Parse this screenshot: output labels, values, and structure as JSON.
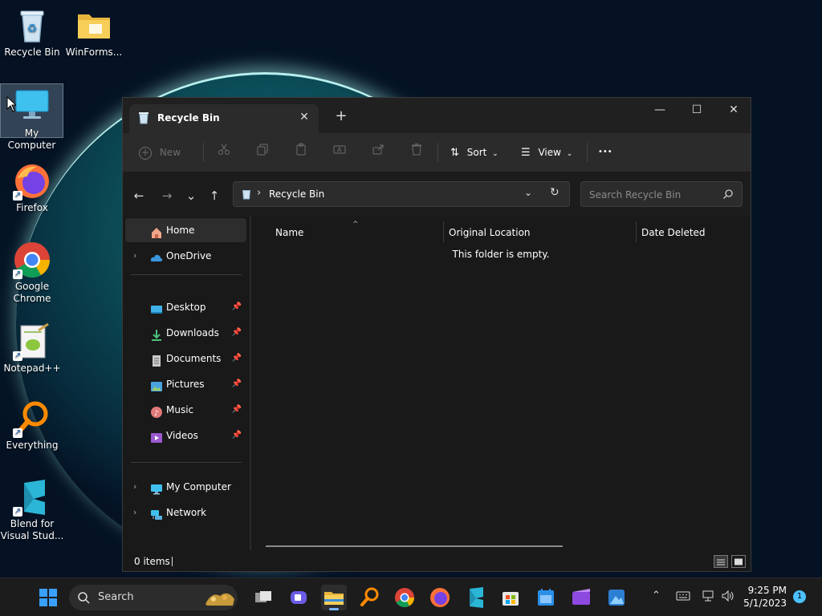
{
  "desktop": {
    "icons": {
      "recycle_bin": "Recycle Bin",
      "winforms": "WinForms...",
      "my_computer": "My Computer",
      "firefox": "Firefox",
      "chrome": "Google Chrome",
      "notepadpp": "Notepad++",
      "everything": "Everything",
      "blend": "Blend for Visual Stud..."
    }
  },
  "window": {
    "tab_title": "Recycle Bin",
    "tab_close_glyph": "✕",
    "new_tab_glyph": "+",
    "controls": {
      "minimize": "—",
      "maximize": "☐",
      "close": "✕"
    },
    "toolbar": {
      "new_label": "New",
      "sort_label": "Sort",
      "view_label": "View",
      "more_glyph": "•••"
    },
    "nav_glyphs": {
      "back": "←",
      "forward": "→",
      "recent": "⌄",
      "up": "↑"
    },
    "address": {
      "separator": "›",
      "location": "Recycle Bin"
    },
    "search": {
      "placeholder": "Search Recycle Bin"
    },
    "navpane": {
      "home": "Home",
      "onedrive": "OneDrive",
      "desktop": "Desktop",
      "downloads": "Downloads",
      "documents": "Documents",
      "pictures": "Pictures",
      "music": "Music",
      "videos": "Videos",
      "my_computer": "My Computer",
      "network": "Network"
    },
    "columns": {
      "name": "Name",
      "original_location": "Original Location",
      "date_deleted": "Date Deleted"
    },
    "empty_message": "This folder is empty.",
    "status": {
      "items": "0 items"
    }
  },
  "taskbar": {
    "search_label": "Search",
    "clock": {
      "time": "9:25 PM",
      "date": "5/1/2023"
    },
    "notification_count": "1"
  },
  "colors": {
    "accent": "#4cc2ff",
    "window_bg": "#191919",
    "toolbar_bg": "#2b2b2b"
  }
}
